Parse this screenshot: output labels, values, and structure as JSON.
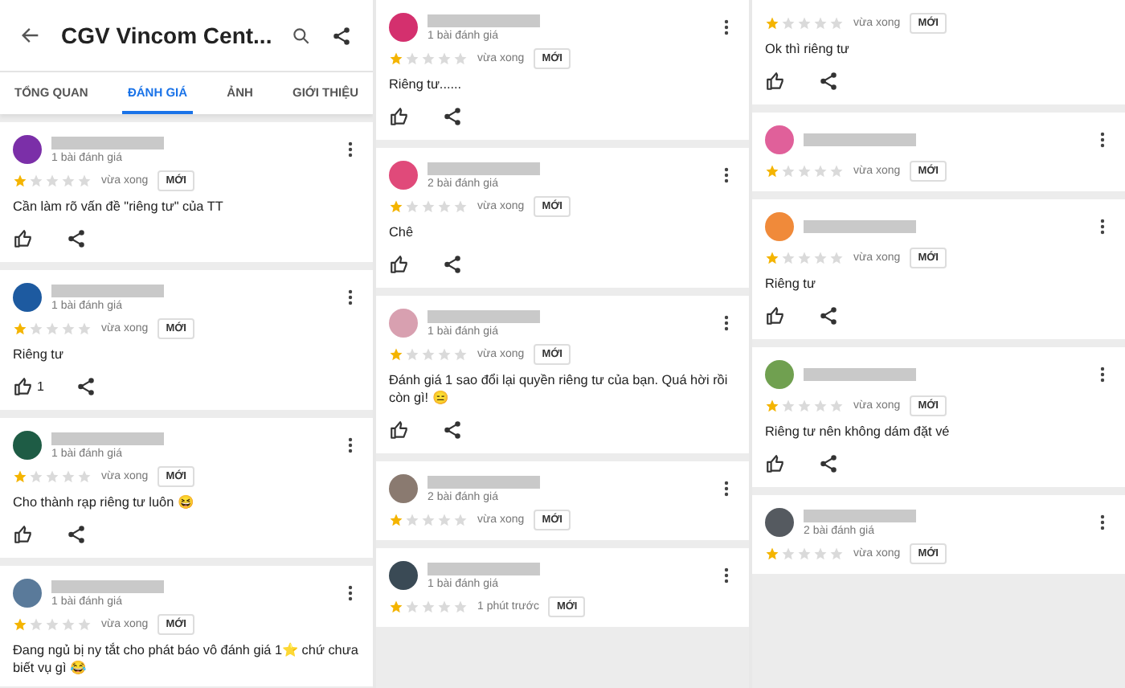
{
  "panels": [
    {
      "header": {
        "title": "CGV Vincom Cent..."
      },
      "tabs": [
        {
          "label": "TỔNG QUAN",
          "selected": false
        },
        {
          "label": "ĐÁNH GIÁ",
          "selected": true
        },
        {
          "label": "ẢNH",
          "selected": false
        },
        {
          "label": "GIỚI THIỆU",
          "selected": false
        }
      ],
      "reviews": [
        {
          "color": "#7b2fa8",
          "review_count": "1 bài đánh giá",
          "stars": 1,
          "time": "vừa xong",
          "badge": "MỚI",
          "text": "Cần làm rõ vấn đề \"riêng tư\" của TT",
          "actions": true
        },
        {
          "color": "#1d5aa0",
          "review_count": "1 bài đánh giá",
          "stars": 1,
          "time": "vừa xong",
          "badge": "MỚI",
          "text": "Riêng tư",
          "actions": true,
          "likes": "1"
        },
        {
          "color": "#1e5c45",
          "review_count": "1 bài đánh giá",
          "stars": 1,
          "time": "vừa xong",
          "badge": "MỚI",
          "text": "Cho thành rạp riêng tư luôn 😆",
          "actions": true
        },
        {
          "color": "#5a7a9a",
          "review_count": "1 bài đánh giá",
          "stars": 1,
          "time": "vừa xong",
          "badge": "MỚI",
          "text": "Đang ngủ bị ny tắt cho phát báo vô đánh giá 1⭐ chứ chưa biết vụ gì 😂",
          "actions": false
        }
      ]
    },
    {
      "reviews": [
        {
          "color": "#d4306e",
          "review_count": "1 bài đánh giá",
          "stars": 1,
          "time": "vừa xong",
          "badge": "MỚI",
          "text": "Riêng tư......",
          "actions": true
        },
        {
          "color": "#e04a7a",
          "review_count": "2 bài đánh giá",
          "stars": 1,
          "time": "vừa xong",
          "badge": "MỚI",
          "text": "Chê",
          "actions": true
        },
        {
          "color": "#d8a0b0",
          "review_count": "1 bài đánh giá",
          "stars": 1,
          "time": "vừa xong",
          "badge": "MỚI",
          "text": "Đánh giá 1 sao đổi lại quyền riêng tư của bạn. Quá hời rồi còn gì! 😑",
          "actions": true
        },
        {
          "color": "#8a7a70",
          "review_count": "2 bài đánh giá",
          "stars": 1,
          "time": "vừa xong",
          "badge": "MỚI",
          "actions": false
        },
        {
          "color": "#3a4a55",
          "review_count": "1 bài đánh giá",
          "stars": 1,
          "time": "1 phút trước",
          "badge": "MỚI",
          "actions": false
        }
      ]
    },
    {
      "reviews": [
        {
          "stars": 1,
          "time": "vừa xong",
          "badge": "MỚI",
          "text": "Ok thì riêng tư",
          "actions": true
        },
        {
          "color": "#e0609a",
          "stars": 1,
          "time": "vừa xong",
          "badge": "MỚI",
          "actions": false
        },
        {
          "color": "#f08a3a",
          "stars": 1,
          "time": "vừa xong",
          "badge": "MỚI",
          "text": "Riêng tư",
          "actions": true
        },
        {
          "color": "#70a050",
          "stars": 1,
          "time": "vừa xong",
          "badge": "MỚI",
          "text": "Riêng tư nên không dám đặt vé",
          "actions": true
        },
        {
          "color": "#555a60",
          "review_count": "2 bài đánh giá",
          "stars": 1,
          "time": "vừa xong",
          "badge": "MỚI",
          "actions": false
        }
      ]
    }
  ]
}
